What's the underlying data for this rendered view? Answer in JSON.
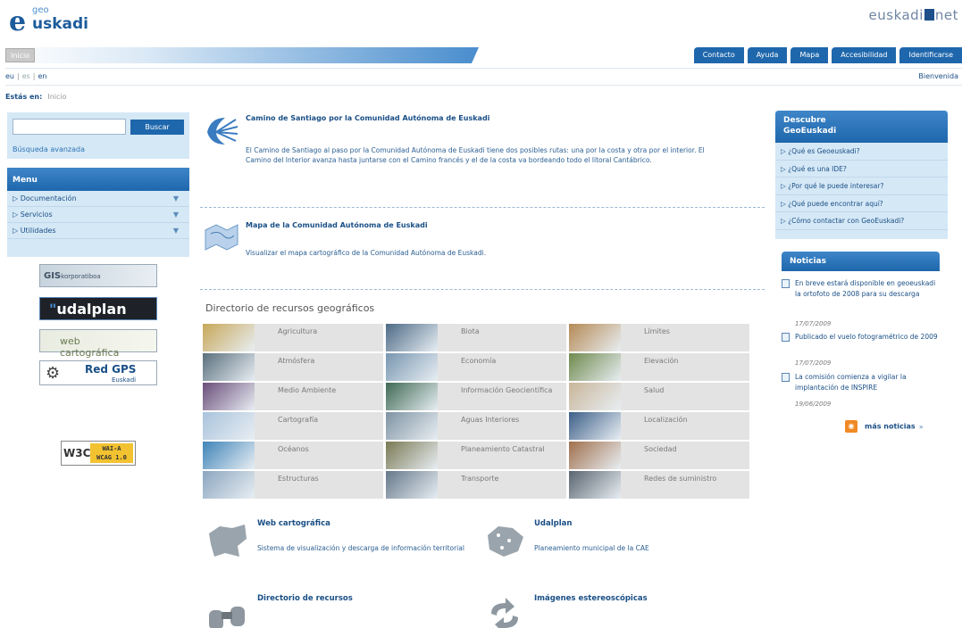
{
  "header": {
    "logo_geo": "geo",
    "logo_e": "e",
    "logo_name": "uskadi",
    "net_logo_left": "euskadi",
    "net_logo_right": "net",
    "inicio_tab": "Inicio",
    "top_tabs": [
      "Contacto",
      "Ayuda",
      "Mapa",
      "Accesibilidad",
      "Identificarse"
    ],
    "languages": [
      "eu",
      "es",
      "en"
    ],
    "bienvenida": "Bienvenida",
    "breadcrumb_label": "Estás en:",
    "breadcrumb_item": "Inicio"
  },
  "search": {
    "button": "Buscar",
    "advanced": "Búsqueda avanzada"
  },
  "menu": {
    "title": "Menu",
    "items": [
      "Documentación",
      "Servicios",
      "Utilidades"
    ]
  },
  "badges": {
    "gis_main": "GIS",
    "gis_sub": "korporatiboa",
    "udalplan_accent": "\"",
    "udalplan_text": "udalplan",
    "web": "web cartográfica",
    "gps_title": "Red GPS",
    "gps_sub": "Euskadi",
    "w3c": "W3C",
    "wai_line1": "WAI-A",
    "wai_line2": "WCAG 1.0"
  },
  "featured": [
    {
      "title": "Camino de Santiago por la Comunidad Autónoma de Euskadi",
      "text": "El Camino de Santiago al paso por la Comunidad Autónoma de Euskadi tiene dos posibles rutas: una por la costa y otra por el interior. El Camino del Interior avanza hasta juntarse con el Camino francés y el de la costa va bordeando todo el litoral Cantábrico."
    },
    {
      "title": "Mapa de la Comunidad Autónoma de Euskadi",
      "text": "Visualizar el mapa cartográfico de la Comunidad Autónoma de Euskadi."
    }
  ],
  "directory": {
    "title": "Directorio de recursos geográficos",
    "cells": [
      {
        "label": "Agricultura",
        "color": "#c8a85a"
      },
      {
        "label": "Biota",
        "color": "#4d6a86"
      },
      {
        "label": "Límites",
        "color": "#b58a55"
      },
      {
        "label": "Atmósfera",
        "color": "#5a6f7d"
      },
      {
        "label": "Economía",
        "color": "#7896b0"
      },
      {
        "label": "Elevación",
        "color": "#6f8a4d"
      },
      {
        "label": "Medio Ambiente",
        "color": "#6a4d7a"
      },
      {
        "label": "Información Geocientífica",
        "color": "#3f6a55"
      },
      {
        "label": "Salud",
        "color": "#c9b59a"
      },
      {
        "label": "Cartografía",
        "color": "#a9c3dc"
      },
      {
        "label": "Aguas Interiores",
        "color": "#7f93a3"
      },
      {
        "label": "Localización",
        "color": "#3d5f88"
      },
      {
        "label": "Océanos",
        "color": "#3f84b8"
      },
      {
        "label": "Planeamiento Catastral",
        "color": "#7a7a55"
      },
      {
        "label": "Sociedad",
        "color": "#a0704d"
      },
      {
        "label": "Estructuras",
        "color": "#8ca6bf"
      },
      {
        "label": "Transporte",
        "color": "#66788a"
      },
      {
        "label": "Redes de suministro",
        "color": "#5a6570"
      }
    ]
  },
  "bottom": [
    {
      "title": "Web cartográfica",
      "text": "Sistema de visualización y descarga de información territorial"
    },
    {
      "title": "Udalplan",
      "text": "Planeamiento municipal de la CAE"
    },
    {
      "title": "Directorio de recursos",
      "text": ""
    },
    {
      "title": "Imágenes estereoscópicas",
      "text": ""
    }
  ],
  "descubre": {
    "title_line1": "Descubre",
    "title_line2": "GeoEuskadi",
    "items": [
      "¿Qué es Geoeuskadi?",
      "¿Qué es una IDE?",
      "¿Por qué le puede interesar?",
      "¿Qué puede encontrar aquí?",
      "¿Cómo contactar con GeoEuskadi?"
    ]
  },
  "noticias": {
    "title": "Noticias",
    "items": [
      {
        "text": "En breve estará disponible en geoeuskadi la ortofoto de 2008 para su descarga",
        "date": "17/07/2009"
      },
      {
        "text": "Publicado el vuelo fotogramétrico de 2009",
        "date": "17/07/2009"
      },
      {
        "text": "La comisión comienza a vigilar la implantación de INSPIRE",
        "date": "19/06/2009"
      }
    ],
    "more": "más noticias"
  },
  "colors": {
    "accent": "#1f67ac",
    "panel": "#d5e8f6",
    "link": "#1a4f86"
  }
}
